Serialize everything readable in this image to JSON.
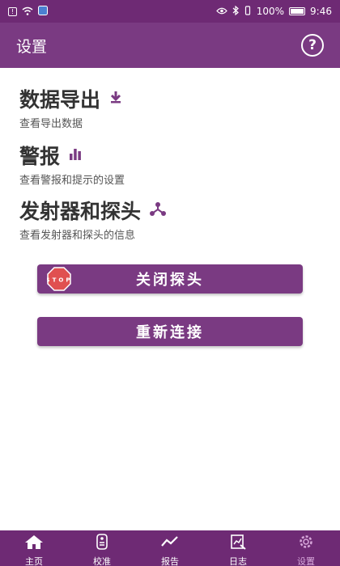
{
  "status_bar": {
    "battery_percent": "100%",
    "time": "9:46"
  },
  "header": {
    "title": "设置"
  },
  "sections": [
    {
      "title": "数据导出",
      "subtitle": "查看导出数据",
      "icon": "download-icon"
    },
    {
      "title": "警报",
      "subtitle": "查看警报和提示的设置",
      "icon": "bar-chart-icon"
    },
    {
      "title": "发射器和探头",
      "subtitle": "查看发射器和探头的信息",
      "icon": "network-icon"
    }
  ],
  "buttons": {
    "stop_probe": "关闭探头",
    "reconnect": "重新连接",
    "stop_sign_text": "STOP"
  },
  "nav": {
    "items": [
      {
        "label": "主页",
        "icon": "home-icon"
      },
      {
        "label": "校准",
        "icon": "calibrate-icon"
      },
      {
        "label": "报告",
        "icon": "report-icon"
      },
      {
        "label": "日志",
        "icon": "log-icon"
      },
      {
        "label": "设置",
        "icon": "gear-icon",
        "active": true
      }
    ]
  },
  "colors": {
    "primary": "#7a3a82",
    "status_bar": "#6e2a74",
    "active_nav": "#d7a7da"
  }
}
